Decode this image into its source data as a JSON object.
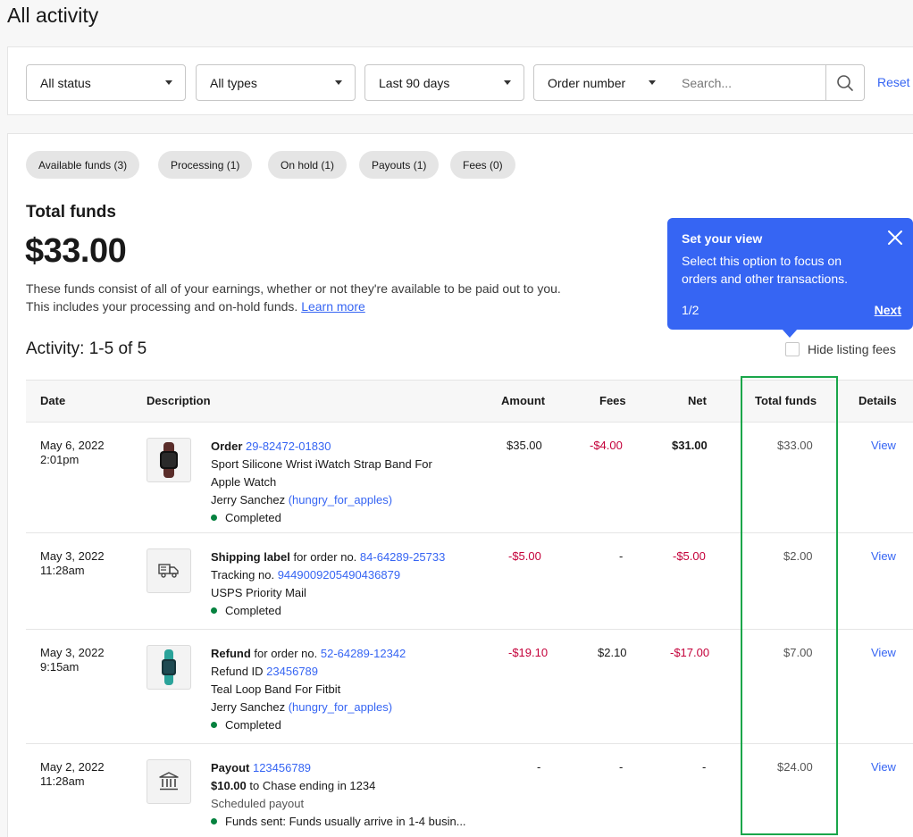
{
  "page": {
    "title": "All activity"
  },
  "filters": {
    "status": "All status",
    "types": "All types",
    "period": "Last 90 days",
    "search_by": "Order number",
    "search_placeholder": "Search...",
    "reset": "Reset"
  },
  "pills": [
    {
      "label": "Available funds (3)"
    },
    {
      "label": "Processing (1)"
    },
    {
      "label": "On hold (1)"
    },
    {
      "label": "Payouts (1)"
    },
    {
      "label": "Fees (0)"
    }
  ],
  "funds": {
    "heading": "Total funds",
    "amount": "$33.00",
    "description": "These funds consist of all of your earnings, whether or not they're available to be paid out to you. This includes your processing and on-hold funds.",
    "learn_more": "Learn more"
  },
  "activity": {
    "label": "Activity: 1-5 of 5",
    "hide_fees_label": "Hide listing fees"
  },
  "tooltip": {
    "title": "Set your view",
    "body": "Select this option to focus on orders and other transactions.",
    "step": "1/2",
    "next": "Next"
  },
  "table": {
    "headers": {
      "date": "Date",
      "description": "Description",
      "amount": "Amount",
      "fees": "Fees",
      "net": "Net",
      "total": "Total funds",
      "details": "Details"
    },
    "rows": [
      {
        "date": "May 6, 2022",
        "time": "2:01pm",
        "kind": "Order",
        "kind_suffix": "",
        "ref": "29-82472-01830",
        "line2": "Sport Silicone Wrist iWatch Strap Band For",
        "line3": "Apple Watch",
        "buyer": "Jerry Sanchez",
        "buyer_handle": "(hungry_for_apples)",
        "status": "Completed",
        "amount": "$35.00",
        "fees": "-$4.00",
        "net": "$31.00",
        "total": "$33.00",
        "details": "View",
        "icon": "watch-band-icon"
      },
      {
        "date": "May 3, 2022",
        "time": "11:28am",
        "kind": "Shipping label",
        "kind_suffix": "for order no.",
        "ref": "84-64289-25733",
        "tracking_label": "Tracking no.",
        "tracking": "9449009205490436879",
        "line3": "USPS Priority Mail",
        "status": "Completed",
        "amount": "-$5.00",
        "fees": "-",
        "net": "-$5.00",
        "total": "$2.00",
        "details": "View",
        "icon": "shipping-truck-icon"
      },
      {
        "date": "May 3, 2022",
        "time": "9:15am",
        "kind": "Refund",
        "kind_suffix": "for order no.",
        "ref": "52-64289-12342",
        "refund_label": "Refund ID",
        "refund_id": "23456789",
        "line3": "Teal Loop Band For Fitbit",
        "buyer": "Jerry Sanchez",
        "buyer_handle": "(hungry_for_apples)",
        "status": "Completed",
        "amount": "-$19.10",
        "fees": "$2.10",
        "net": "-$17.00",
        "total": "$7.00",
        "details": "View",
        "icon": "fitbit-band-icon"
      },
      {
        "date": "May 2, 2022",
        "time": "11:28am",
        "kind": "Payout",
        "ref": "123456789",
        "payout_amount": "$10.00",
        "payout_dest": "to Chase ending in 1234",
        "line3": "Scheduled payout",
        "status": "Funds sent:",
        "status_note": "Funds usually arrive in 1-4 busin...",
        "amount": "-",
        "fees": "-",
        "net": "-",
        "total": "$24.00",
        "details": "View",
        "icon": "bank-icon"
      }
    ]
  },
  "colors": {
    "link": "#3665f3",
    "negative": "#c4003a",
    "status_dot": "#05823f",
    "tooltip_bg": "#3665f3",
    "highlight": "#1aa64a"
  }
}
